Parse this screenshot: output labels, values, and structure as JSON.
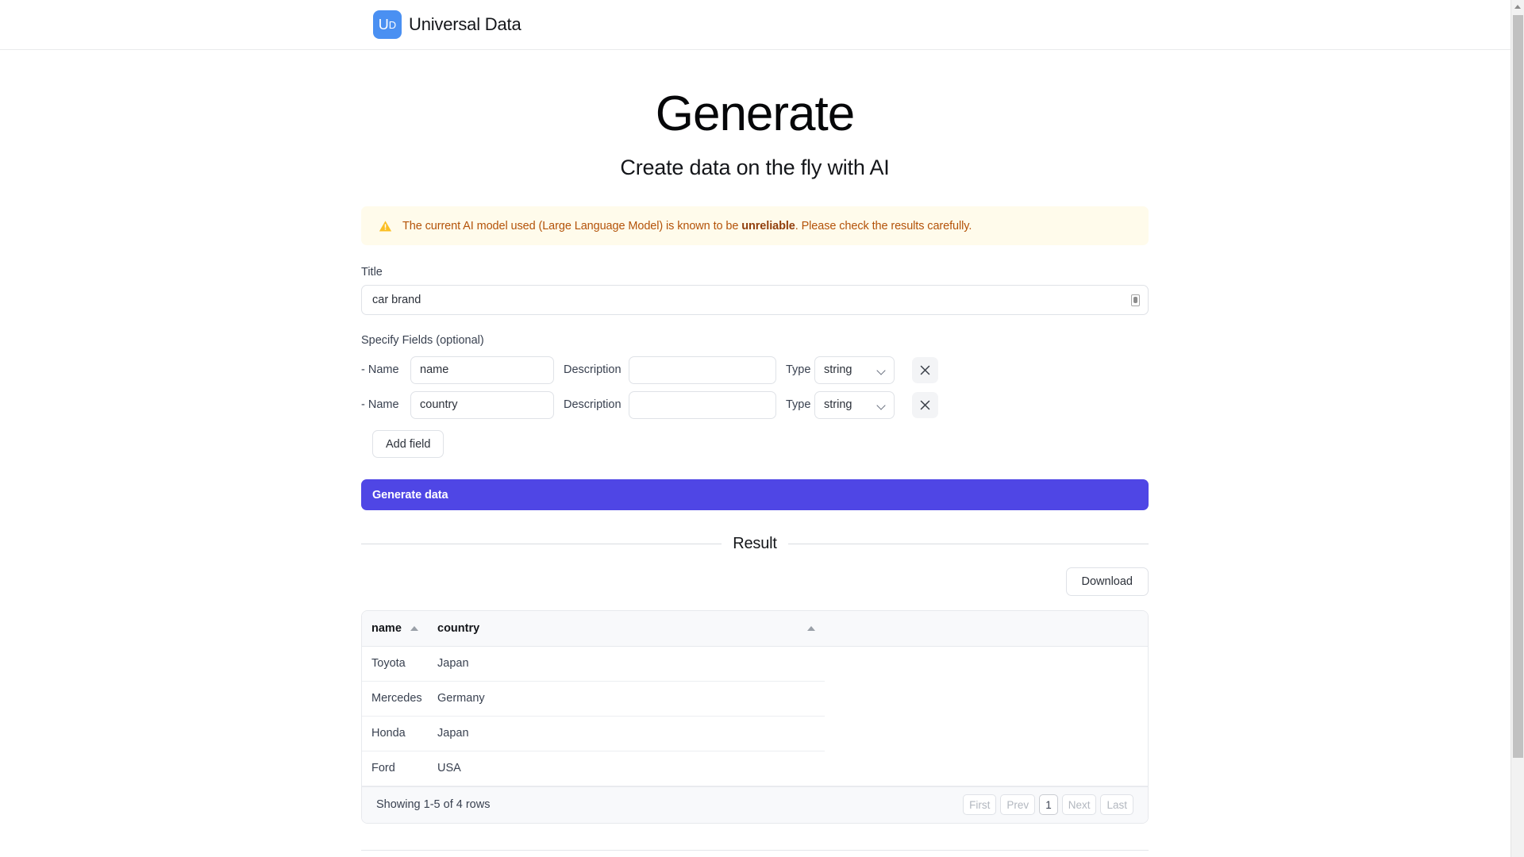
{
  "header": {
    "logo_text_primary": "U",
    "logo_text_secondary": "D",
    "brand_name": "Universal Data",
    "logo_color": "#4a90f2"
  },
  "hero": {
    "title": "Generate",
    "subtitle": "Create data on the fly with AI"
  },
  "warning": {
    "icon": "warning-triangle-icon",
    "text_before": "The current AI model used (Large Language Model) is known to be ",
    "emphasis": "unreliable",
    "text_after": ". Please check the results carefully.",
    "background": "#fffbeb",
    "text_color": "#b45309"
  },
  "form": {
    "title_label": "Title",
    "title_value": "car brand",
    "title_placeholder": "",
    "title_input_icon": "microphone-icon",
    "fields_label": "Specify Fields (optional)",
    "name_label": "- Name",
    "description_label": "Description",
    "type_label": "Type",
    "fields": [
      {
        "name_value": "name",
        "description_value": "",
        "description_placeholder": "",
        "type_value": "string",
        "remove_label": "×"
      },
      {
        "name_value": "country",
        "description_value": "",
        "description_placeholder": "",
        "type_value": "string",
        "remove_label": "×"
      }
    ],
    "add_field_label": "Add field",
    "generate_label": "Generate data",
    "generate_color": "#4f46e5"
  },
  "result": {
    "section_label": "Result",
    "download_label": "Download",
    "table": {
      "columns": [
        {
          "key": "name",
          "label": "name",
          "sort": "asc"
        },
        {
          "key": "country",
          "label": "country",
          "sort": "asc"
        }
      ],
      "rows": [
        {
          "name": "Toyota",
          "country": "Japan"
        },
        {
          "name": "Mercedes",
          "country": "Germany"
        },
        {
          "name": "Honda",
          "country": "Japan"
        },
        {
          "name": "Ford",
          "country": "USA"
        }
      ]
    },
    "footer": {
      "showing_text": "Showing 1-5 of 4 rows",
      "pager": {
        "first": "First",
        "prev": "Prev",
        "current_page": "1",
        "next": "Next",
        "last": "Last"
      }
    }
  }
}
